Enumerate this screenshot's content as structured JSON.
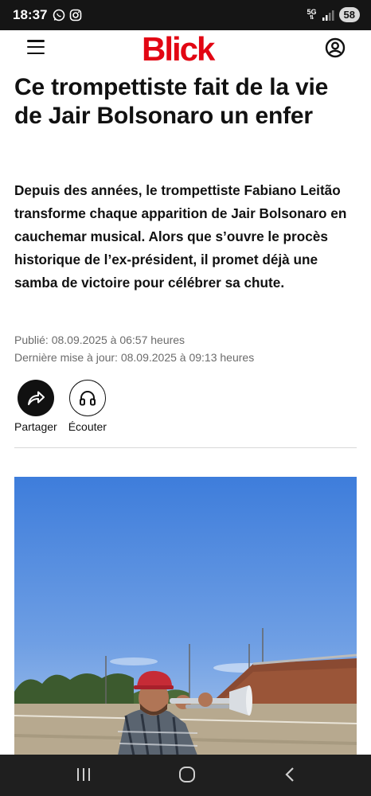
{
  "status_bar": {
    "time": "18:37",
    "network": "5G",
    "battery": "58"
  },
  "header": {
    "logo": "Blick",
    "brand_color": "#e20613"
  },
  "article": {
    "title": "Ce trompettiste fait de la vie de Jair Bolsonaro un enfer",
    "lead": "Depuis des années, le trompettiste Fabiano Leitão transforme chaque apparition de Jair Bolsonaro en cauchemar musical. Alors que s’ouvre le procès historique de l’ex-président, il promet déjà une samba de victoire pour célébrer sa chute.",
    "published": "Publié: 08.09.2025 à 06:57 heures",
    "updated": "Dernière mise à jour: 08.09.2025 à 09:13 heures",
    "actions": {
      "share_label": "Partager",
      "listen_label": "Écouter"
    }
  },
  "icons": {
    "status_apps": [
      "whatsapp-icon",
      "instagram-icon"
    ],
    "status_right": [
      "network-5g-icon",
      "signal-icon",
      "battery-icon"
    ],
    "header": [
      "menu-icon",
      "account-icon"
    ],
    "actions": [
      "share-icon",
      "headphones-icon"
    ],
    "navigation": [
      "recent-apps-icon",
      "home-icon",
      "back-icon"
    ]
  }
}
